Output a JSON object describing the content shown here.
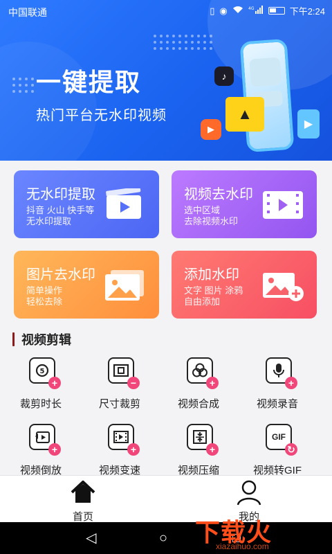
{
  "status_bar": {
    "carrier": "中国联通",
    "time": "下午2:24",
    "signal": "4G"
  },
  "banner": {
    "title": "一键提取",
    "subtitle": "热门平台无水印视频"
  },
  "feature_cards": [
    {
      "title": "无水印提取",
      "desc": "抖音 火山 快手等\n无水印提取",
      "icon": "video-clip-icon"
    },
    {
      "title": "视频去水印",
      "desc": "选中区域\n去除视频水印",
      "icon": "film-strip-icon"
    },
    {
      "title": "图片去水印",
      "desc": "简单操作\n轻松去除",
      "icon": "image-icon"
    },
    {
      "title": "添加水印",
      "desc": "文字 图片 涂鸦\n自由添加",
      "icon": "image-add-icon"
    }
  ],
  "section": {
    "title": "视频剪辑"
  },
  "tools": [
    {
      "label": "裁剪时长",
      "icon": "timer-icon",
      "badge": "+"
    },
    {
      "label": "尺寸裁剪",
      "icon": "crop-icon",
      "badge": "−"
    },
    {
      "label": "视频合成",
      "icon": "merge-circles-icon",
      "badge": "+"
    },
    {
      "label": "视频录音",
      "icon": "microphone-icon",
      "badge": "+"
    },
    {
      "label": "视频倒放",
      "icon": "reverse-play-icon",
      "badge": "+"
    },
    {
      "label": "视频变速",
      "icon": "film-speed-icon",
      "badge": "+"
    },
    {
      "label": "视频压缩",
      "icon": "compress-icon",
      "badge": "+"
    },
    {
      "label": "视频转GIF",
      "icon": "gif-icon",
      "badge": "↻"
    }
  ],
  "gif_icon_text": "GIF",
  "bottom_nav": [
    {
      "label": "首页",
      "icon": "home-icon"
    },
    {
      "label": "我的",
      "icon": "user-icon"
    }
  ],
  "watermark": {
    "logo": "下载火",
    "url": "xiazaihuo.com"
  }
}
